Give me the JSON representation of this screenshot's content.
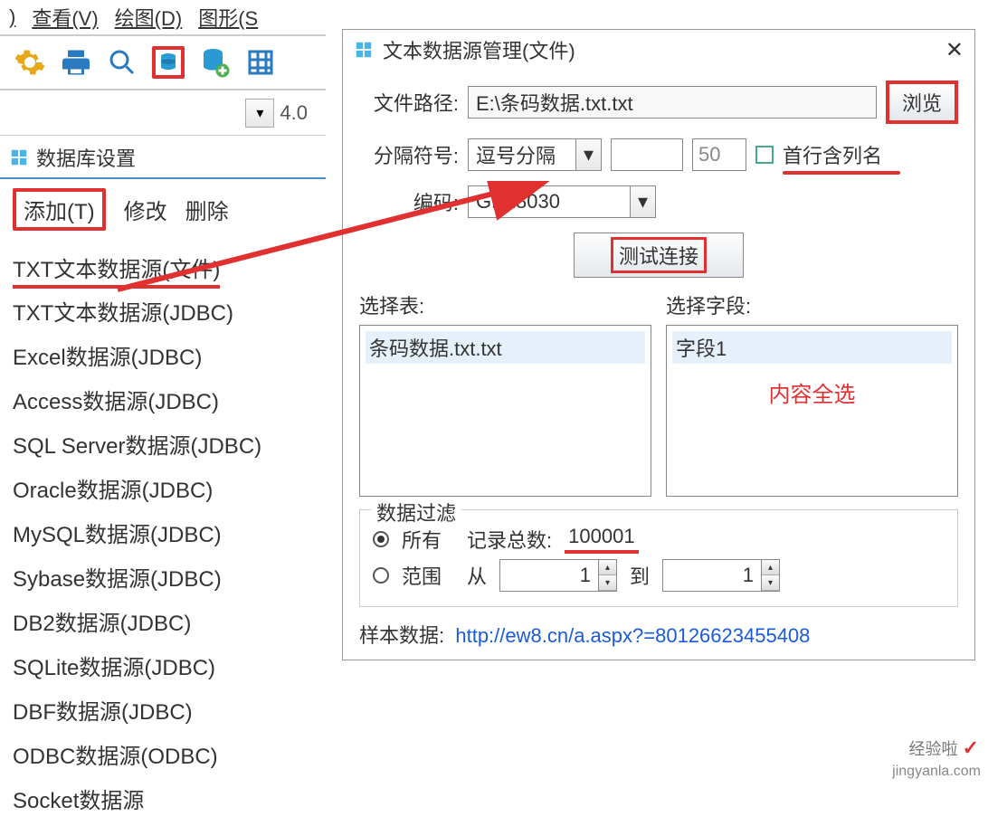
{
  "menubar": {
    "item1": ")",
    "view": "查看(V)",
    "draw": "绘图(D)",
    "shapes": "图形(S"
  },
  "toolbar": {
    "gear": "settings-icon",
    "print": "print-icon",
    "search": "search-icon",
    "db": "database-icon",
    "db2": "database-add-icon",
    "grid": "grid-icon"
  },
  "zoom": {
    "value": "4.0"
  },
  "db_panel": {
    "title": "数据库设置",
    "add": "添加(T)",
    "edit": "修改",
    "delete": "删除",
    "items": [
      "TXT文本数据源(文件)",
      "TXT文本数据源(JDBC)",
      "Excel数据源(JDBC)",
      "Access数据源(JDBC)",
      "SQL Server数据源(JDBC)",
      "Oracle数据源(JDBC)",
      "MySQL数据源(JDBC)",
      "Sybase数据源(JDBC)",
      "DB2数据源(JDBC)",
      "SQLite数据源(JDBC)",
      "DBF数据源(JDBC)",
      "ODBC数据源(ODBC)",
      "Socket数据源"
    ]
  },
  "dialog": {
    "title": "文本数据源管理(文件)",
    "path_label": "文件路径:",
    "path_value": "E:\\条码数据.txt.txt",
    "browse": "浏览",
    "delim_label": "分隔符号:",
    "delim_value": "逗号分隔",
    "delim_small": "50",
    "first_row": "首行含列名",
    "enc_label": "编码:",
    "enc_value": "GB18030",
    "test": "测试连接",
    "select_table": "选择表:",
    "select_field": "选择字段:",
    "table_item": "条码数据.txt.txt",
    "field_item": "字段1",
    "note": "内容全选",
    "filter_title": "数据过滤",
    "radio_all": "所有",
    "record_count_label": "记录总数:",
    "record_count": "100001",
    "radio_range": "范围",
    "from_label": "从",
    "from_val": "1",
    "to_label": "到",
    "to_val": "1",
    "sample_label": "样本数据:",
    "sample_url": "http://ew8.cn/a.aspx?=80126623455408"
  },
  "watermark": {
    "top": "经验啦 ✓",
    "url": "jingyanla.com"
  }
}
